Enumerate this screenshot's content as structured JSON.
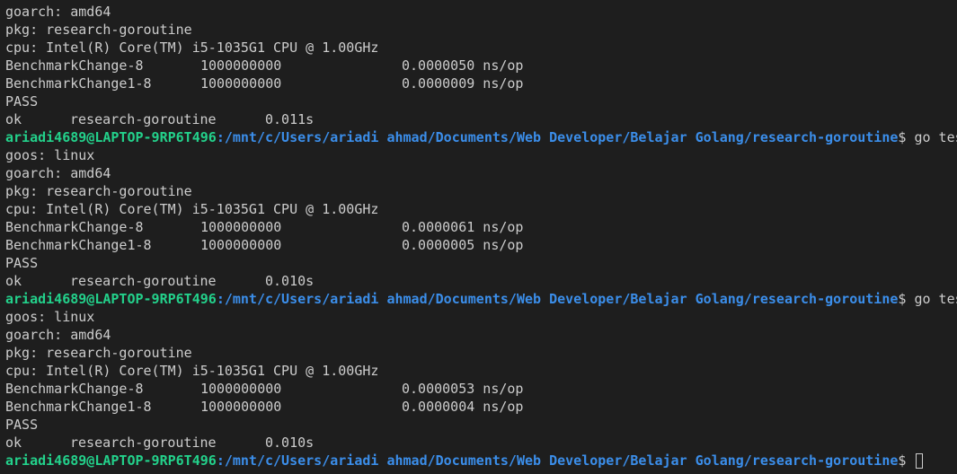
{
  "prompt": {
    "user": "ariadi4689@LAPTOP-9RP6T496",
    "path": ":/mnt/c/Users/ariadi ahmad/Documents/Web Developer/Belajar Golang/research-goroutine",
    "dollar": "$ ",
    "command": "go test -bench=."
  },
  "env": {
    "goos": "goos: linux",
    "goarch": "goarch: amd64",
    "pkg": "pkg: research-goroutine",
    "cpu": "cpu: Intel(R) Core(TM) i5-1035G1 CPU @ 1.00GHz"
  },
  "runs": [
    {
      "benchmarks": [
        {
          "name": "BenchmarkChange-8",
          "iterations": "1000000000",
          "result": "0.0000050 ns/op"
        },
        {
          "name": "BenchmarkChange1-8",
          "iterations": "1000000000",
          "result": "0.0000009 ns/op"
        }
      ],
      "status": "PASS",
      "ok": {
        "label": "ok",
        "package": "research-goroutine",
        "time": "0.011s"
      }
    },
    {
      "benchmarks": [
        {
          "name": "BenchmarkChange-8",
          "iterations": "1000000000",
          "result": "0.0000061 ns/op"
        },
        {
          "name": "BenchmarkChange1-8",
          "iterations": "1000000000",
          "result": "0.0000005 ns/op"
        }
      ],
      "status": "PASS",
      "ok": {
        "label": "ok",
        "package": "research-goroutine",
        "time": "0.010s"
      }
    },
    {
      "benchmarks": [
        {
          "name": "BenchmarkChange-8",
          "iterations": "1000000000",
          "result": "0.0000053 ns/op"
        },
        {
          "name": "BenchmarkChange1-8",
          "iterations": "1000000000",
          "result": "0.0000004 ns/op"
        }
      ],
      "status": "PASS",
      "ok": {
        "label": "ok",
        "package": "research-goroutine",
        "time": "0.010s"
      }
    }
  ],
  "colors": {
    "background": "#1e1e1e",
    "text": "#cccccc",
    "prompt_user": "#23d18b",
    "prompt_path": "#3b8eea"
  }
}
